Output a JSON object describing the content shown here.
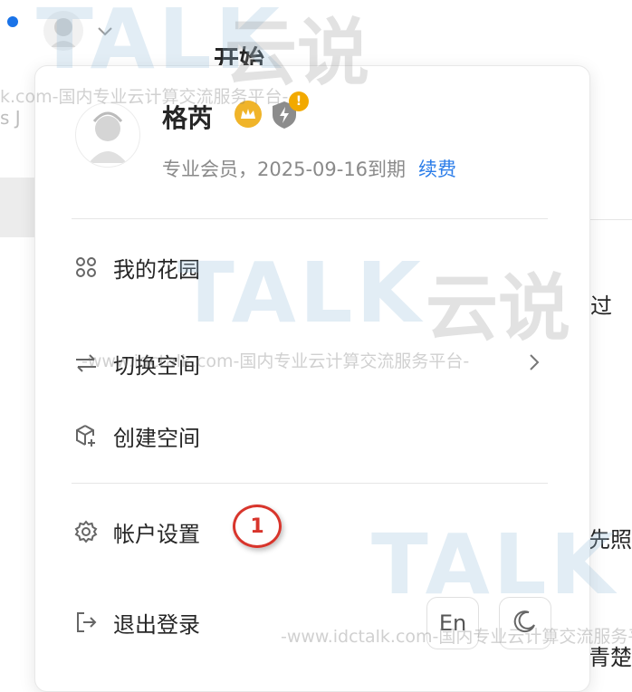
{
  "background": {
    "title": "开始",
    "right_text_1": "过",
    "right_text_2": "先照",
    "right_text_3": "青楚",
    "left_partial_text": "s J"
  },
  "profile": {
    "username": "格芮",
    "membership": "专业会员，2025-09-16到期",
    "renew_label": "续费",
    "alert_badge": "!"
  },
  "menu": [
    {
      "label": "我的花园",
      "icon": "garden-grid-icon"
    },
    {
      "label": "切换空间",
      "icon": "switch-arrows-icon",
      "has_submenu": true
    },
    {
      "label": "创建空间",
      "icon": "cube-plus-icon"
    },
    {
      "label": "帐户设置",
      "icon": "gear-icon"
    },
    {
      "label": "退出登录",
      "icon": "logout-icon"
    }
  ],
  "annotation": {
    "step": "1"
  },
  "footer": {
    "language_label": "En",
    "theme_icon": "moon-icon"
  },
  "watermark": {
    "brand": "TALK",
    "brand_cn": "云说",
    "url_line": "-www.idctalk.com-国内专业云计算交流服务平台-",
    "url_line_short": "k.com-国内专业云计算交流服务平台-"
  },
  "colors": {
    "accent_blue": "#2b7de9",
    "annotation_red": "#d8352c",
    "crown_gold": "#f0b429"
  }
}
